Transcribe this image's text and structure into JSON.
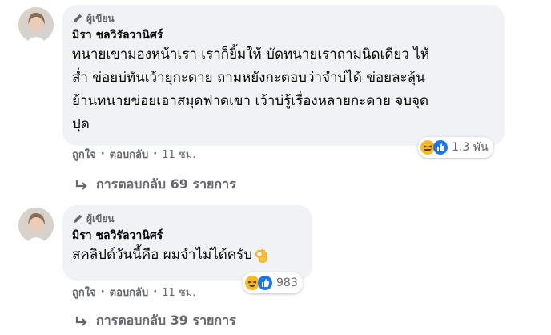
{
  "comments": [
    {
      "badge": "ผู้เขียน",
      "author": "มิรา ชลวิรัลวานิศร์",
      "text": "ทนายเขามองหน้าเรา เราก็ยิ้มให้ บัดทนายเราถามนิดเดียว ไห้\nส่ำ ข่อยบ่ทันเว้ายุกะดาย ถามหยังกะตอบว่าจำบ่ได้ ข่อยละลุ้น\nย้านทนายข่อยเอาสมุดฟาดเขา เว้าบ่รู้เรื่องหลายกะดาย จบจุด\nปุด",
      "reaction_count": "1.3 พัน",
      "like": "ถูกใจ",
      "reply": "ตอบกลับ",
      "time": "11 ชม.",
      "replies_label": "การตอบกลับ 69 รายการ"
    },
    {
      "badge": "ผู้เขียน",
      "author": "มิรา ชลวิรัลวานิศร์",
      "text": "สคลิปต์วันนี้คือ ผมจำไม่ได้ครับ",
      "reaction_count": "983",
      "like": "ถูกใจ",
      "reply": "ตอบกลับ",
      "time": "11 ชม.",
      "replies_label": "การตอบกลับ 39 รายการ"
    }
  ],
  "separator": "·",
  "colors": {
    "bubble": "#f0f2f5",
    "muted": "#65676b",
    "like_blue": "#1877f2",
    "haha_yellow": "#f7b928"
  },
  "icons": [
    "pen-icon",
    "haha-icon",
    "like-icon",
    "reply-arrow-icon",
    "ok-hand-icon"
  ]
}
